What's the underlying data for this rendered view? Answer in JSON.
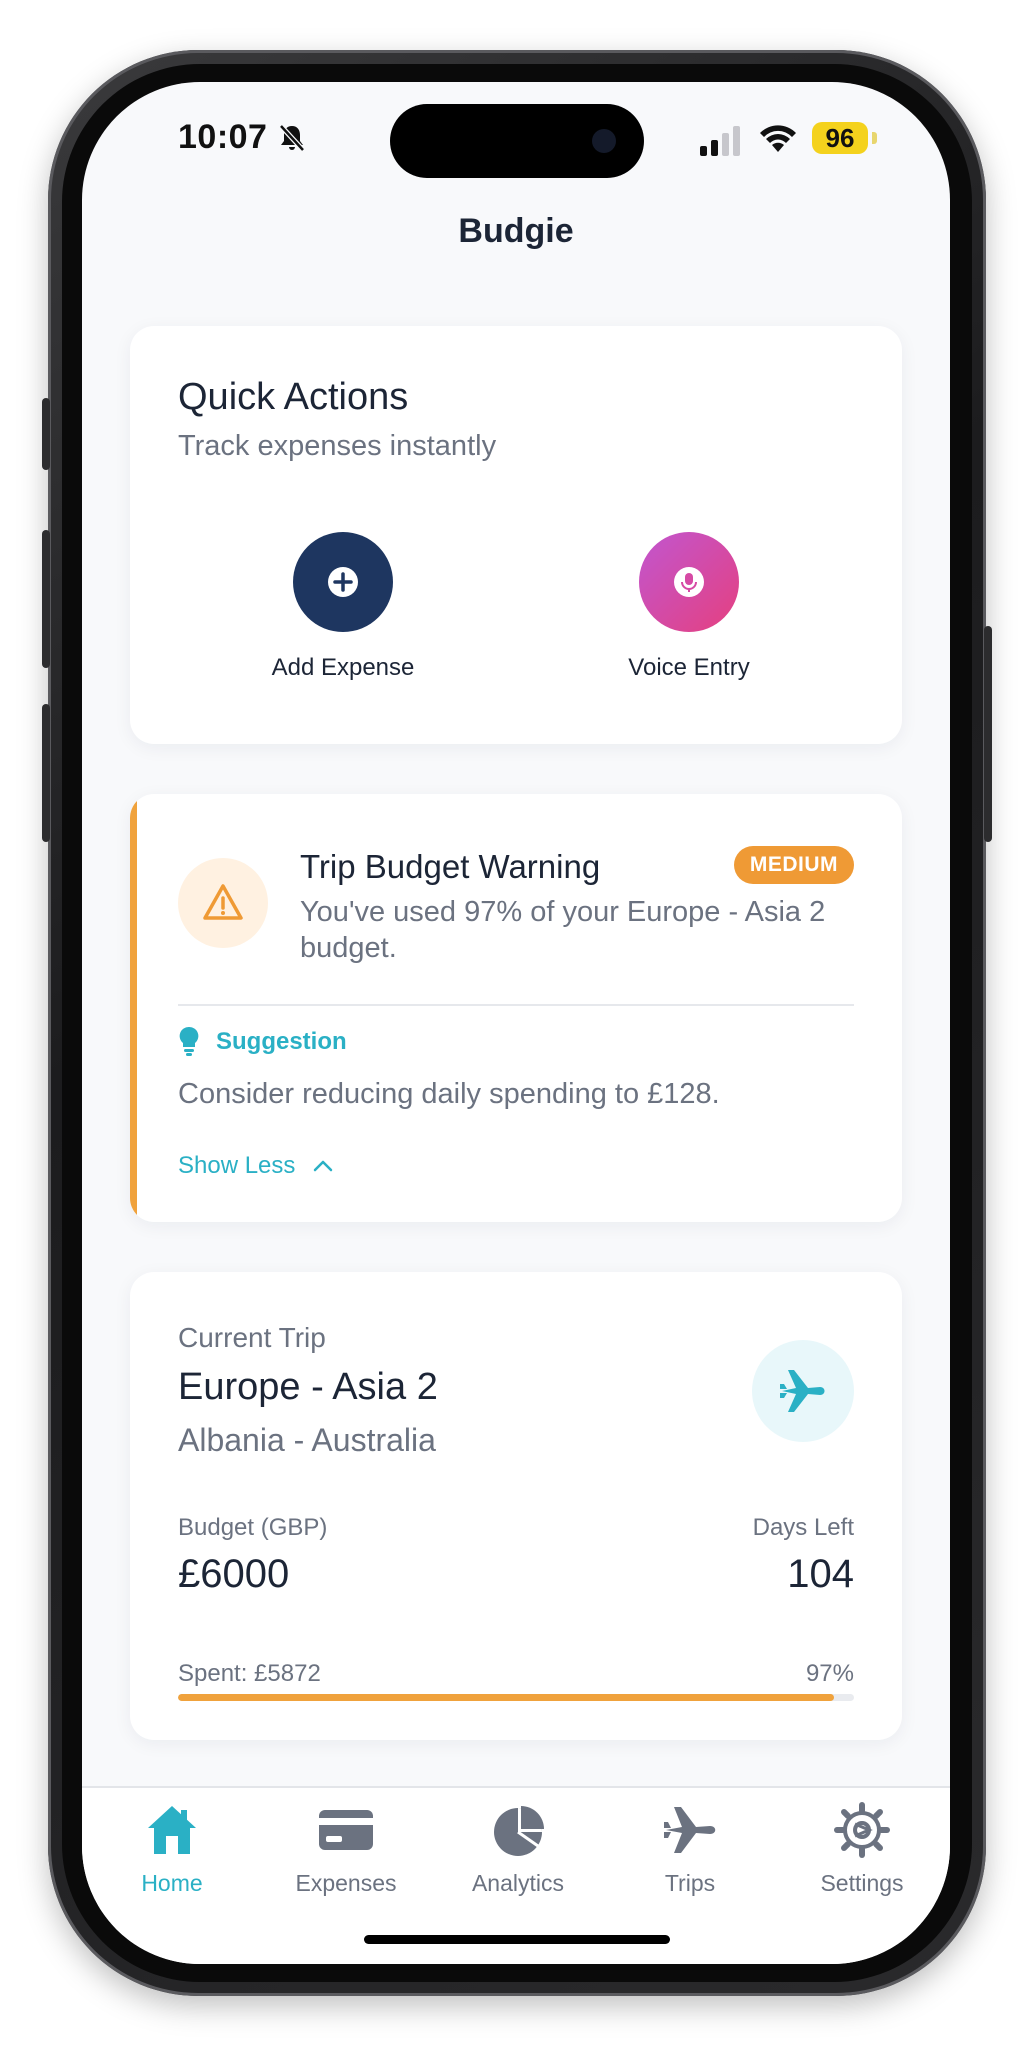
{
  "status_bar": {
    "time": "10:07",
    "battery": "96",
    "icons": [
      "bell-slash-icon",
      "cellular-signal-icon",
      "wifi-icon",
      "battery-icon"
    ]
  },
  "header": {
    "title": "Budgie"
  },
  "quick_actions": {
    "title": "Quick Actions",
    "subtitle": "Track expenses instantly",
    "add_expense_label": "Add Expense",
    "voice_entry_label": "Voice Entry"
  },
  "warning": {
    "title": "Trip Budget Warning",
    "badge": "MEDIUM",
    "message": "You've used 97% of your Europe - Asia 2 budget.",
    "suggestion_label": "Suggestion",
    "suggestion_text": "Consider reducing daily spending to £128.",
    "toggle_label": "Show Less"
  },
  "trip": {
    "label": "Current Trip",
    "name": "Europe - Asia 2",
    "route": "Albania - Australia",
    "budget_label": "Budget (GBP)",
    "budget_value": "£6000",
    "days_left_label": "Days Left",
    "days_left_value": "104",
    "spent_text": "Spent: £5872",
    "percent_text": "97%",
    "progress_fraction": 0.97
  },
  "tabs": [
    {
      "label": "Home",
      "icon": "home-icon",
      "active": true
    },
    {
      "label": "Expenses",
      "icon": "card-icon",
      "active": false
    },
    {
      "label": "Analytics",
      "icon": "pie-chart-icon",
      "active": false
    },
    {
      "label": "Trips",
      "icon": "airplane-icon",
      "active": false
    },
    {
      "label": "Settings",
      "icon": "gear-icon",
      "active": false
    }
  ],
  "colors": {
    "accent": "#2ab0c5",
    "warning": "#f0a23c",
    "navy": "#1e3660",
    "inactive_tab": "#6b7280"
  }
}
